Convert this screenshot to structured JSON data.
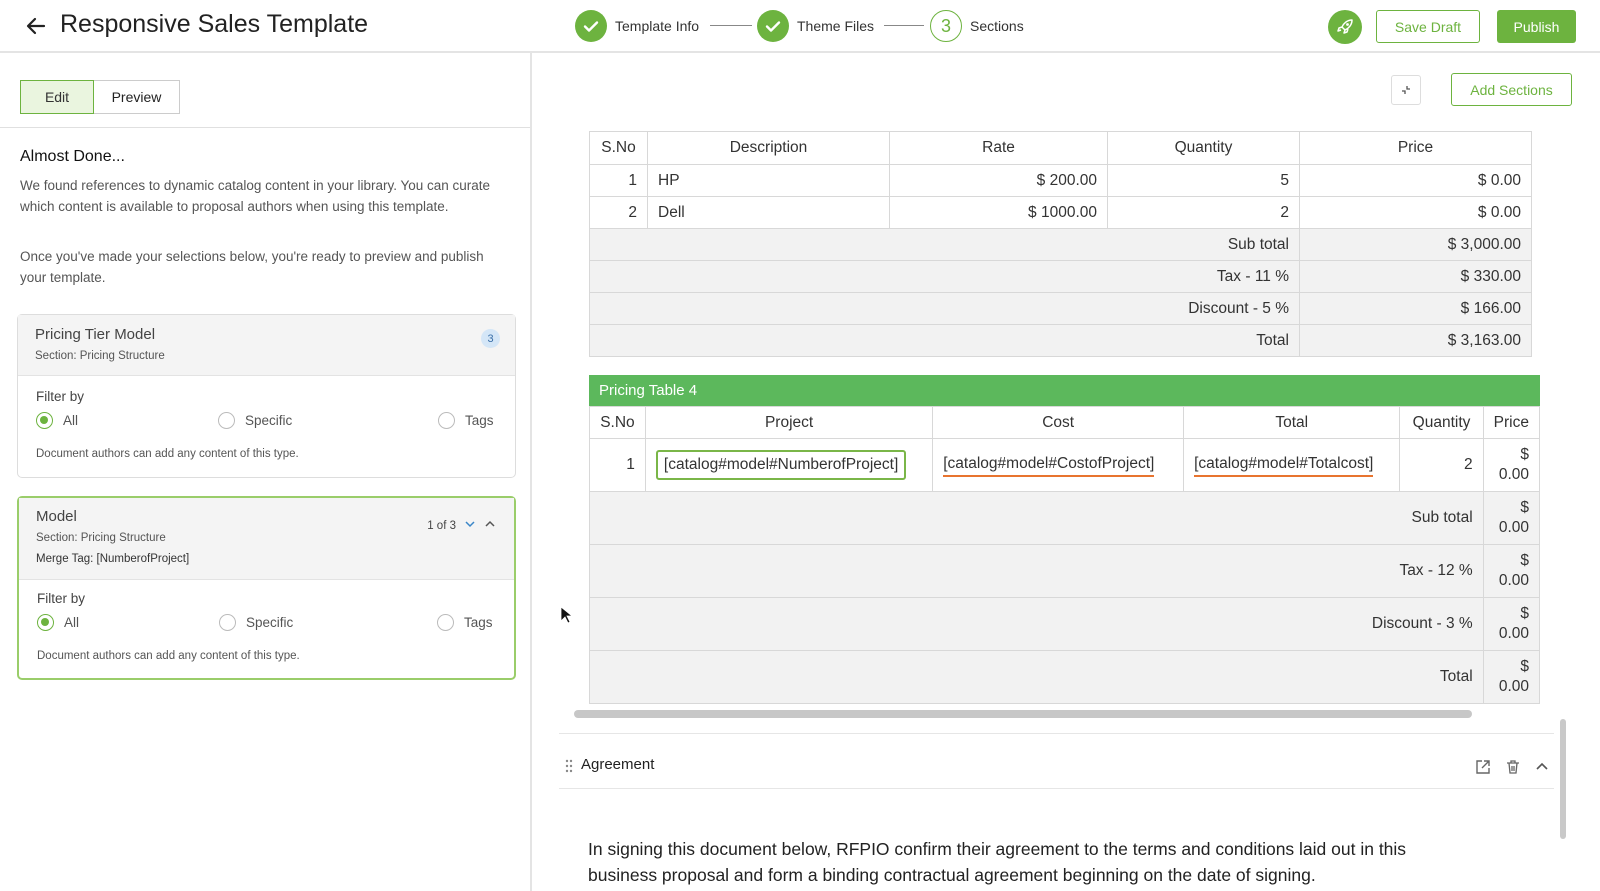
{
  "header": {
    "title": "Responsive Sales Template",
    "steps": [
      {
        "label": "Template Info",
        "state": "done"
      },
      {
        "label": "Theme Files",
        "state": "done"
      },
      {
        "label": "Sections",
        "state": "current",
        "number": "3"
      }
    ],
    "save_draft": "Save Draft",
    "publish": "Publish",
    "accent": "#6db33f"
  },
  "left": {
    "tabs": {
      "edit": "Edit",
      "preview": "Preview"
    },
    "heading": "Almost Done...",
    "para1": "We found references to dynamic catalog content in your library. You can curate which content is available to proposal authors when using this template.",
    "para2": "Once you've made your selections below, you're ready to preview and publish your template.",
    "cards": [
      {
        "title": "Pricing Tier Model",
        "section": "Section: Pricing Structure",
        "badge": "3",
        "filter_label": "Filter by",
        "options": [
          "All",
          "Specific",
          "Tags"
        ],
        "selected": "All",
        "note": "Document authors can add any content of this type."
      },
      {
        "title": "Model",
        "section": "Section: Pricing Structure",
        "merge_tag": "Merge Tag: [NumberofProject]",
        "pager": "1 of 3",
        "filter_label": "Filter by",
        "options": [
          "All",
          "Specific",
          "Tags"
        ],
        "selected": "All",
        "note": "Document authors can add any content of this type."
      }
    ]
  },
  "main": {
    "add_sections": "Add Sections",
    "table3": {
      "headers": [
        "S.No",
        "Description",
        "Rate",
        "Quantity",
        "Price"
      ],
      "rows": [
        [
          "1",
          "HP",
          "$ 200.00",
          "5",
          "$ 0.00"
        ],
        [
          "2",
          "Dell",
          "$ 1000.00",
          "2",
          "$ 0.00"
        ]
      ],
      "summary": [
        [
          "Sub total",
          "$ 3,000.00"
        ],
        [
          "Tax - 11 %",
          "$ 330.00"
        ],
        [
          "Discount - 5 %",
          "$ 166.00"
        ],
        [
          "Total",
          "$ 3,163.00"
        ]
      ]
    },
    "table4": {
      "title": "Pricing Table 4",
      "headers": [
        "S.No",
        "Project",
        "Cost",
        "Total",
        "Quantity",
        "Price"
      ],
      "row": [
        "1",
        "[catalog#model#NumberofProject]",
        "[catalog#model#CostofProject]",
        "[catalog#model#Totalcost]",
        "2",
        "$",
        "0.00"
      ],
      "summary": [
        [
          "Sub total",
          "$",
          "0.00"
        ],
        [
          "Tax - 12 %",
          "$",
          "0.00"
        ],
        [
          "Discount - 3 %",
          "$",
          "0.00"
        ],
        [
          "Total",
          "$",
          "0.00"
        ]
      ]
    },
    "agreement": {
      "title": "Agreement",
      "text_line1": "In signing this document below,  RFPIO confirm their agreement to the terms and conditions laid out in this",
      "text_line2": "business proposal and form a binding contractual agreement beginning on the date of signing."
    }
  }
}
